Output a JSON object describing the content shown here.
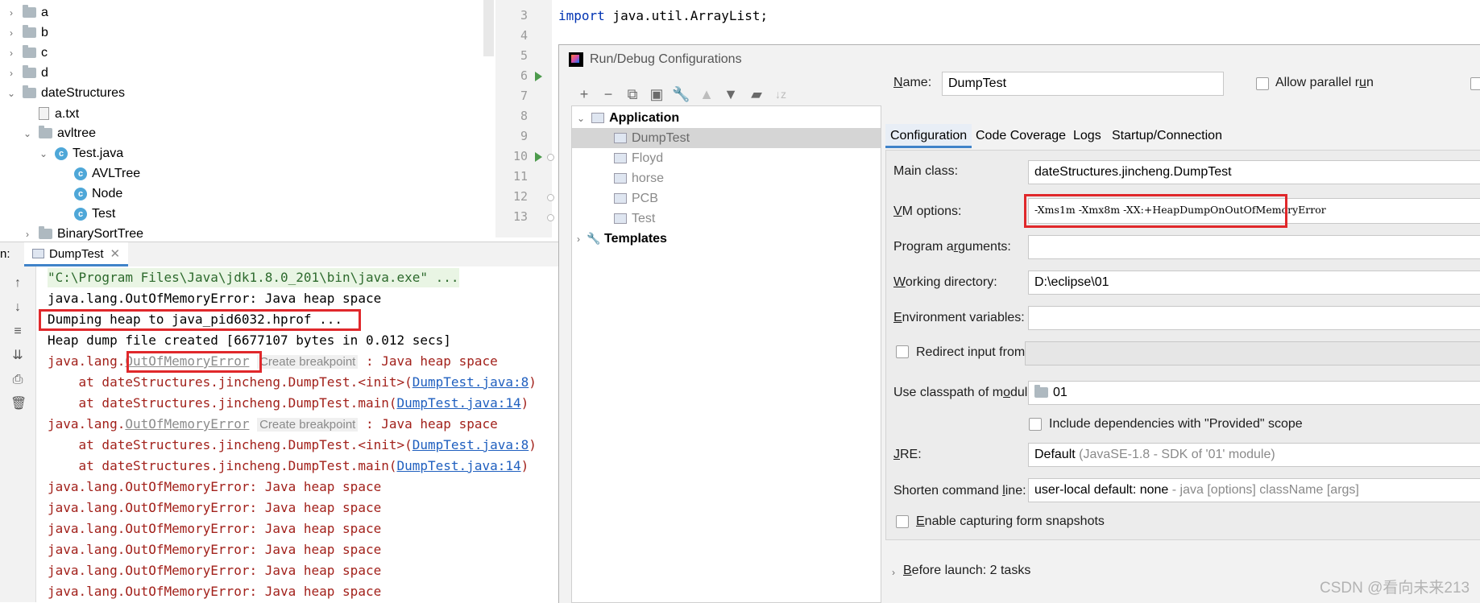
{
  "project_tree": {
    "items": [
      {
        "label": "a",
        "type": "folder",
        "depth": 0,
        "expanded": false
      },
      {
        "label": "b",
        "type": "folder",
        "depth": 0,
        "expanded": false
      },
      {
        "label": "c",
        "type": "folder",
        "depth": 0,
        "expanded": false
      },
      {
        "label": "d",
        "type": "folder",
        "depth": 0,
        "expanded": false
      },
      {
        "label": "dateStructures",
        "type": "folder",
        "depth": 0,
        "expanded": true
      },
      {
        "label": "a.txt",
        "type": "file",
        "depth": 1
      },
      {
        "label": "avltree",
        "type": "folder",
        "depth": 1,
        "expanded": true
      },
      {
        "label": "Test.java",
        "type": "java",
        "depth": 2,
        "expanded": true
      },
      {
        "label": "AVLTree",
        "type": "class",
        "depth": 3
      },
      {
        "label": "Node",
        "type": "class",
        "depth": 3
      },
      {
        "label": "Test",
        "type": "class",
        "depth": 3
      },
      {
        "label": "BinarySortTree",
        "type": "folder",
        "depth": 1,
        "expanded": false
      }
    ]
  },
  "editor": {
    "line_numbers": [
      "3",
      "4",
      "5",
      "6",
      "7",
      "8",
      "9",
      "10",
      "11",
      "12",
      "13"
    ],
    "code_line_keyword": "import",
    "code_line_rest": " java.util.ArrayList;"
  },
  "run_panel": {
    "prefix": "n:",
    "tab_label": "DumpTest",
    "console": {
      "cmd": "\"C:\\Program Files\\Java\\jdk1.8.0_201\\bin\\java.exe\" ...",
      "line1": "java.lang.OutOfMemoryError: Java heap space",
      "dumping": "Dumping heap to java_pid6032.hprof ...",
      "created": "Heap dump file created [6677107 bytes in 0.012 secs]",
      "exc_prefix": "java.lang.",
      "exc_name": "OutOfMemoryError",
      "create_breakpoint": "Create breakpoint",
      "exc_suffix": " : Java heap space",
      "at_init": "    at dateStructures.jincheng.DumpTest.<init>(",
      "at_init_link": "DumpTest.java:8",
      "at_main": "    at dateStructures.jincheng.DumpTest.main(",
      "at_main_link": "DumpTest.java:14",
      "close_paren": ")",
      "repeat_line": "java.lang.OutOfMemoryError: Java heap space"
    }
  },
  "dialog": {
    "title": "Run/Debug Configurations",
    "toolbar": [
      "add-icon",
      "remove-icon",
      "copy-icon",
      "save-icon",
      "wrench-icon",
      "move-up-icon",
      "move-down-icon",
      "folder-icon",
      "sort-icon"
    ],
    "tree": {
      "application": "Application",
      "configs": [
        "DumpTest",
        "Floyd",
        "horse",
        "PCB",
        "Test"
      ],
      "selected": "DumpTest",
      "templates": "Templates"
    },
    "name_label_u": "N",
    "name_label_rest": "ame:",
    "name_value": "DumpTest",
    "allow_parallel_pre": "Allow parallel r",
    "allow_parallel_u": "u",
    "allow_parallel_post": "n",
    "tabs": [
      "Configuration",
      "Code Coverage",
      "Logs",
      "Startup/Connection"
    ],
    "active_tab": "Configuration",
    "main_class_label": "Main class:",
    "main_class_value": "dateStructures.jincheng.DumpTest",
    "vm_label_u": "V",
    "vm_label_rest": "M options:",
    "vm_value": "-Xms1m -Xmx8m -XX:+HeapDumpOnOutOfMemoryError",
    "prog_args_label_pre": "Program a",
    "prog_args_label_u": "r",
    "prog_args_label_post": "guments:",
    "workdir_label_u": "W",
    "workdir_label_rest": "orking directory:",
    "workdir_value": "D:\\eclipse\\01",
    "env_label_u": "E",
    "env_label_rest": "nvironment variables:",
    "redirect_label": "Redirect input from:",
    "classpath_label_pre": "Use classpath of m",
    "classpath_label_u": "o",
    "classpath_label_post": "dule:",
    "classpath_value": "01",
    "include_deps": "Include dependencies with \"Provided\" scope",
    "jre_label_u": "J",
    "jre_label_rest": "RE:",
    "jre_value": "Default",
    "jre_hint": " (JavaSE-1.8 - SDK of '01' module)",
    "shorten_label_pre": "Shorten command ",
    "shorten_label_u": "l",
    "shorten_label_post": "ine:",
    "shorten_value": "user-local default: none",
    "shorten_hint": " - java [options] className [args]",
    "capture_u": "E",
    "capture_rest": "nable capturing form snapshots",
    "before_launch_u": "B",
    "before_launch_rest": "efore launch: 2 tasks"
  },
  "watermark": "CSDN @看向未来213",
  "colors": {
    "accent": "#4083c9",
    "highlight_box": "#e0282b",
    "error_text": "#a2211b",
    "link": "#1f5fbf",
    "selected_row": "#d5d5d5"
  }
}
